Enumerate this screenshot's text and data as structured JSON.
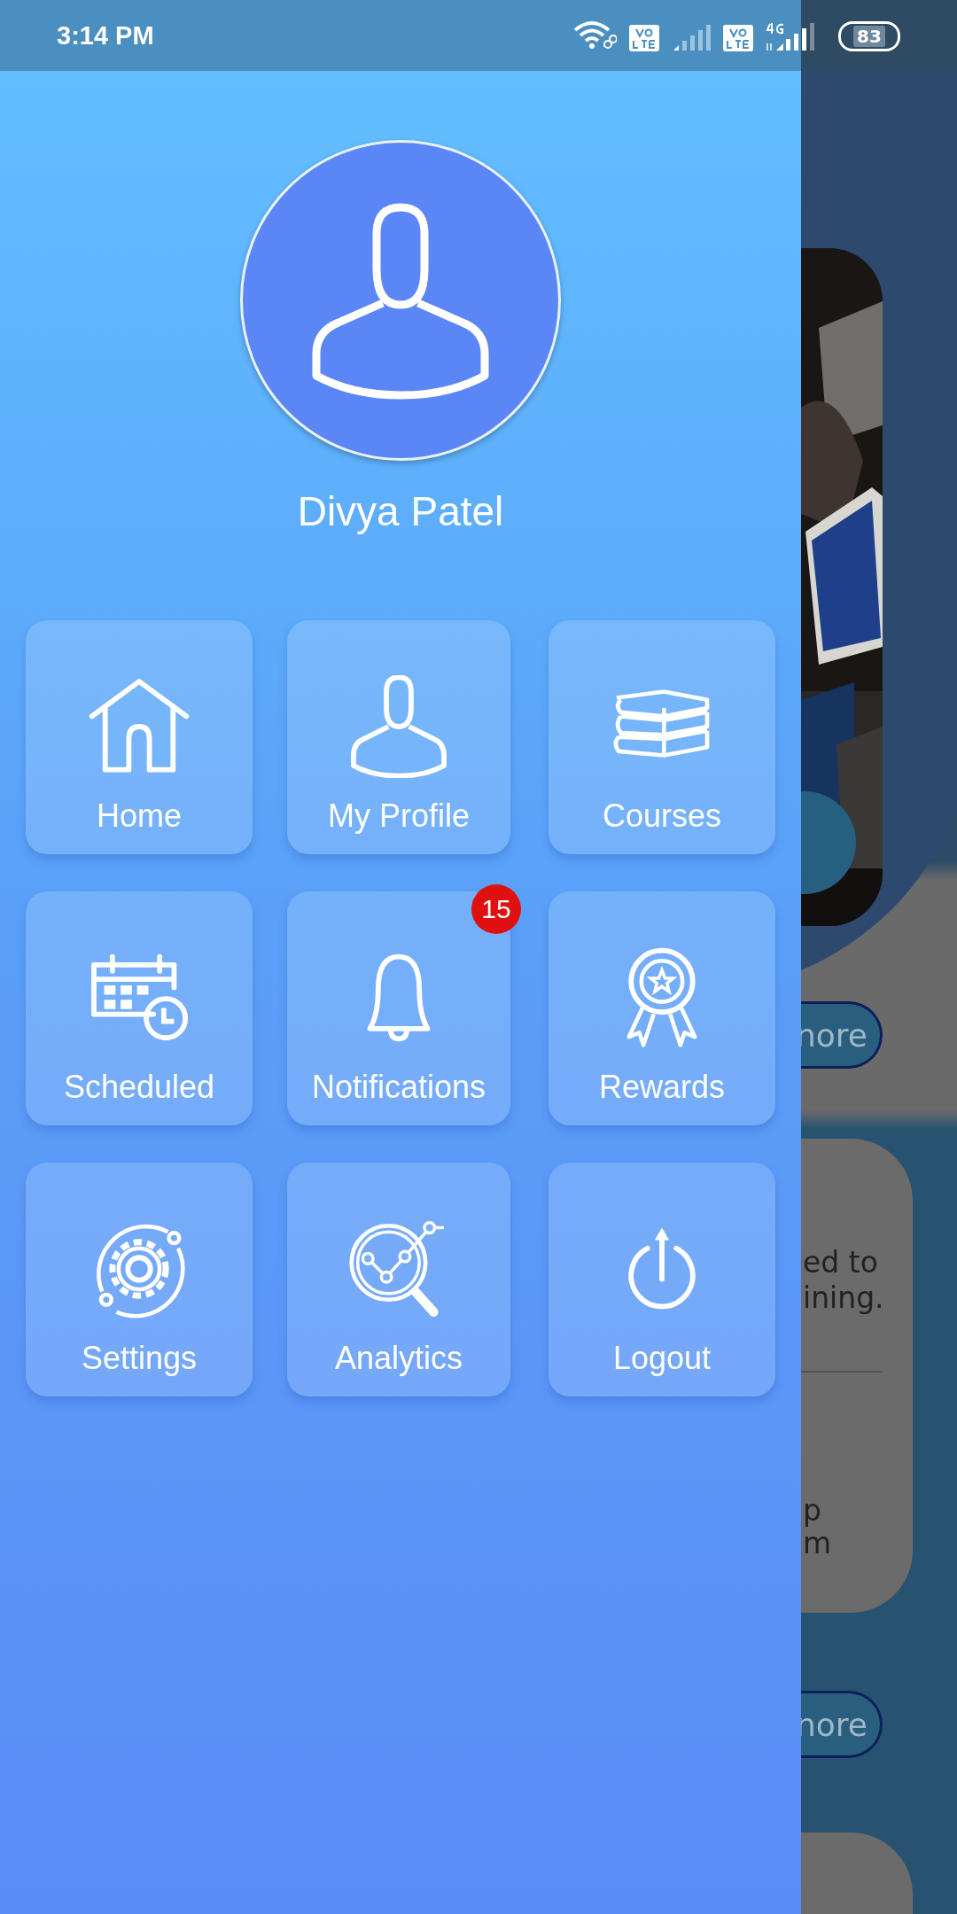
{
  "status_bar": {
    "time": "3:14 PM",
    "battery": "83"
  },
  "drawer": {
    "user_name": "Divya Patel",
    "notifications_badge": "15",
    "menu": [
      {
        "label": "Home",
        "kind": "home"
      },
      {
        "label": "My Profile",
        "kind": "profile"
      },
      {
        "label": "Courses",
        "kind": "courses"
      },
      {
        "label": "Scheduled",
        "kind": "scheduled"
      },
      {
        "label": "Notifications",
        "kind": "notifications"
      },
      {
        "label": "Rewards",
        "kind": "rewards"
      },
      {
        "label": "Settings",
        "kind": "settings"
      },
      {
        "label": "Analytics",
        "kind": "analytics"
      },
      {
        "label": "Logout",
        "kind": "logout"
      }
    ]
  },
  "background_page": {
    "more_buttons": [
      "nore",
      "nore"
    ],
    "card_lines": [
      "ed to",
      "ining."
    ],
    "card_lines_2": [
      "p",
      "m"
    ]
  }
}
